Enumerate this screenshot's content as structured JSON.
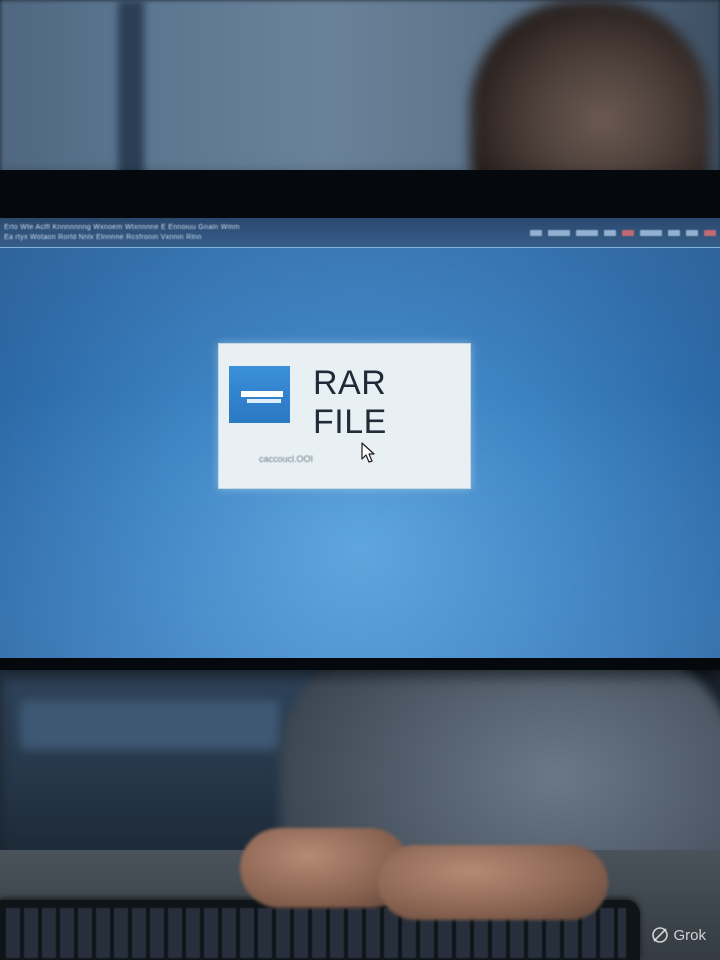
{
  "taskbar": {
    "line1": "Erto  Wte Aclfl Knnnnnnng  Wxnoem Wtxnnnne E Ennoiuu Gnaln Wmm",
    "line2": "Ea rtyx Wotaon  Rorld  Nnlx Elnnnne  Rcsfronin  Vxnnin Rlnn"
  },
  "dialog": {
    "title": "RAR FILE",
    "subtitle": "caccoucl.OOI"
  },
  "icons": {
    "file": "rar-file-icon",
    "cursor": "mouse-pointer-icon",
    "watermark": "grok-logo-icon"
  },
  "watermark": {
    "label": "Grok"
  },
  "colors": {
    "screen": "#3f86c6",
    "dialog": "#e8f0f4",
    "file_icon": "#2b78c4"
  }
}
